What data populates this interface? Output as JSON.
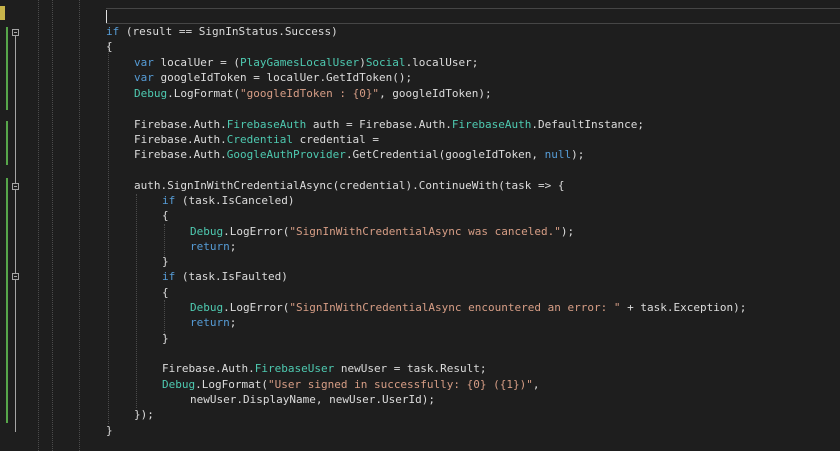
{
  "colors": {
    "background": "#1e1e1e",
    "keyword": "#569cd6",
    "type": "#4ec9b0",
    "string": "#d69d85",
    "plain": "#dcdcdc",
    "change_marker": "#57a64a",
    "bookmark": "#c8b44a"
  },
  "code": {
    "line_1_if": "if",
    "line_1_rest": " (result == SignInStatus.Success)",
    "line_2": "{",
    "line_3_kw": "var",
    "line_3_a": " localUer = (",
    "line_3_type": "PlayGamesLocalUser",
    "line_3_b": ")",
    "line_3_type2": "Social",
    "line_3_c": ".localUser;",
    "line_4_kw": "var",
    "line_4_rest": " googleIdToken = localUer.GetIdToken();",
    "line_5_type": "Debug",
    "line_5_a": ".LogFormat(",
    "line_5_str": "\"googleIdToken : {0}\"",
    "line_5_b": ", googleIdToken);",
    "line_7_a": "Firebase.Auth.",
    "line_7_type": "FirebaseAuth",
    "line_7_b": " auth = Firebase.Auth.",
    "line_7_type2": "FirebaseAuth",
    "line_7_c": ".DefaultInstance;",
    "line_8_a": "Firebase.Auth.",
    "line_8_type": "Credential",
    "line_8_b": " credential =",
    "line_9_a": "Firebase.Auth.",
    "line_9_type": "GoogleAuthProvider",
    "line_9_b": ".GetCredential(googleIdToken, ",
    "line_9_kw": "null",
    "line_9_c": ");",
    "line_11": "auth.SignInWithCredentialAsync(credential).ContinueWith(task => {",
    "line_12_kw": "if",
    "line_12_rest": " (task.IsCanceled)",
    "line_13": "{",
    "line_14_type": "Debug",
    "line_14_a": ".LogError(",
    "line_14_str": "\"SignInWithCredentialAsync was canceled.\"",
    "line_14_b": ");",
    "line_15_kw": "return",
    "line_15_rest": ";",
    "line_16": "}",
    "line_17_kw": "if",
    "line_17_rest": " (task.IsFaulted)",
    "line_18": "{",
    "line_19_type": "Debug",
    "line_19_a": ".LogError(",
    "line_19_str": "\"SignInWithCredentialAsync encountered an error: \"",
    "line_19_b": " + task.Exception);",
    "line_20_kw": "return",
    "line_20_rest": ";",
    "line_21": "}",
    "line_23_a": "Firebase.Auth.",
    "line_23_type": "FirebaseUser",
    "line_23_b": " newUser = task.Result;",
    "line_24_type": "Debug",
    "line_24_a": ".LogFormat(",
    "line_24_str": "\"User signed in successfully: {0} ({1})\"",
    "line_24_b": ",",
    "line_25": "newUser.DisplayName, newUser.UserId);",
    "line_26": "});",
    "line_27": "}"
  }
}
